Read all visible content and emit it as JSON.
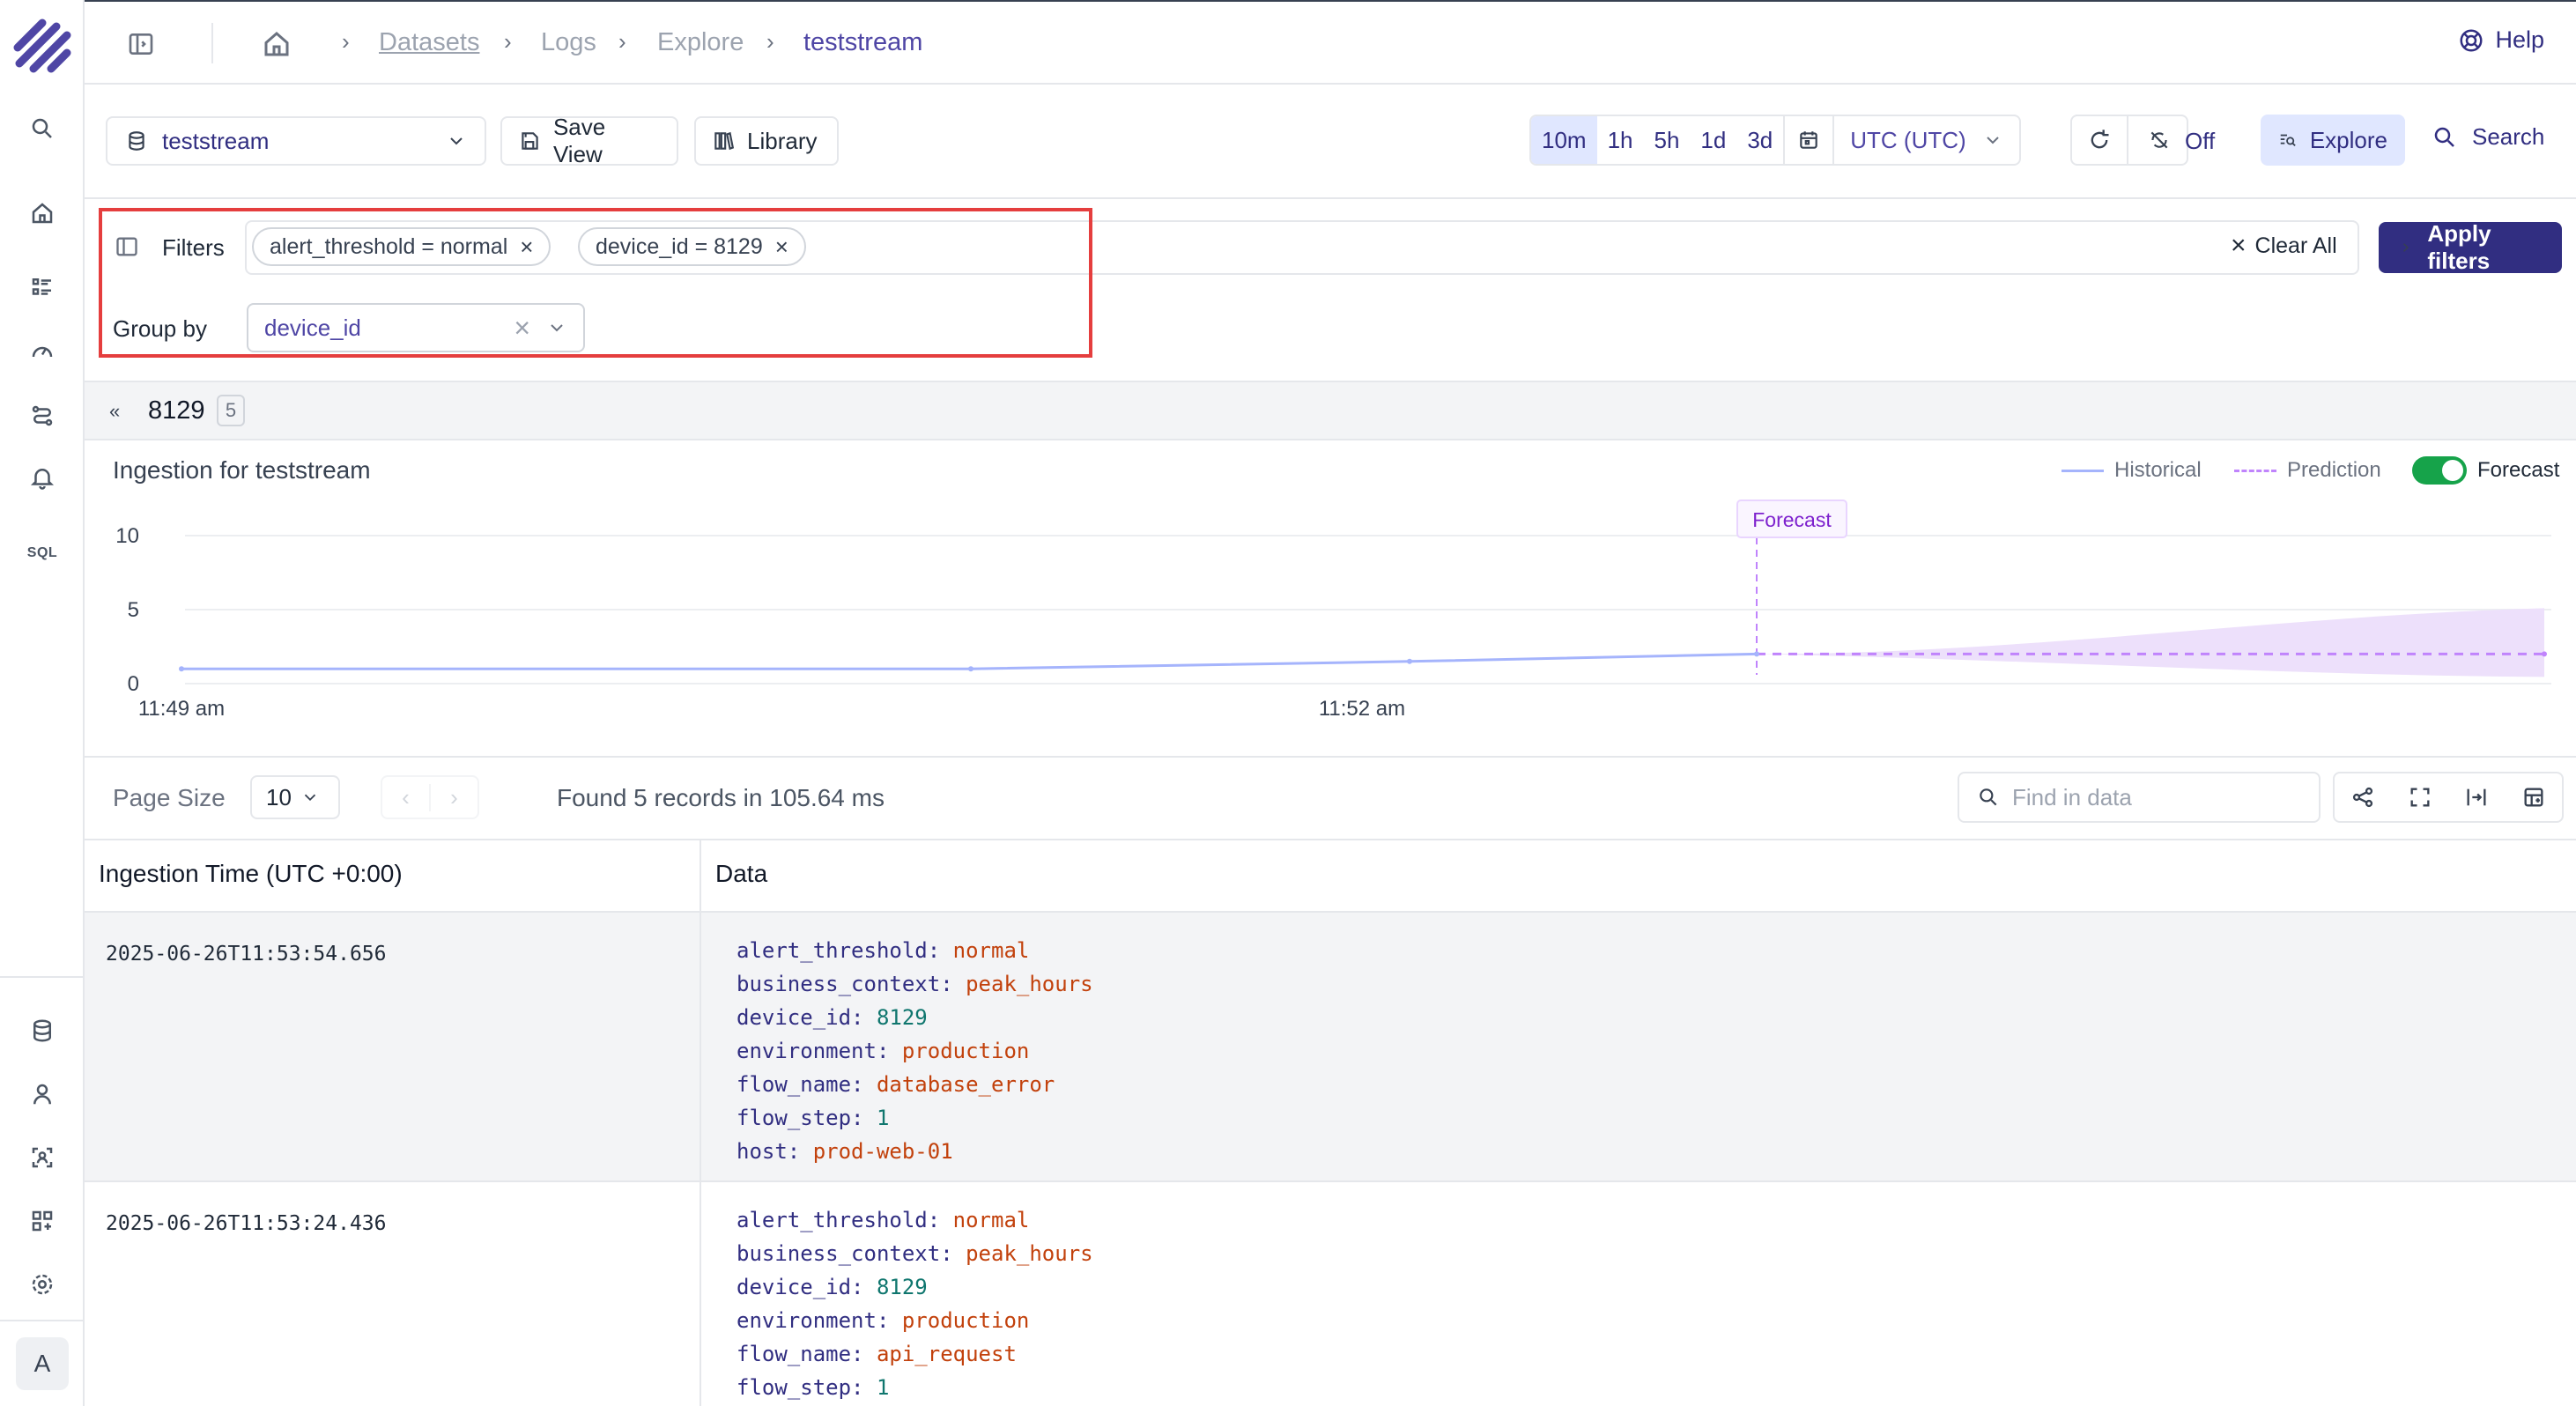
{
  "breadcrumb": [
    "Datasets",
    "Logs",
    "Explore",
    "teststream"
  ],
  "help_label": "Help",
  "toolbar": {
    "stream": "teststream",
    "save_view": "Save View",
    "library": "Library",
    "time_ranges": [
      "10m",
      "1h",
      "5h",
      "1d",
      "3d"
    ],
    "active_range": "10m",
    "timezone": "UTC (UTC)",
    "refresh_state": "Off",
    "explore": "Explore",
    "search": "Search"
  },
  "filters": {
    "label": "Filters",
    "chips": [
      "alert_threshold = normal",
      "device_id = 8129"
    ],
    "clear_all": "Clear All",
    "apply": "Apply filters",
    "group_by_label": "Group by",
    "group_by_value": "device_id"
  },
  "group": {
    "name": "8129",
    "count": "5"
  },
  "chart_data": {
    "type": "line",
    "title": "Ingestion for teststream",
    "legend": [
      "Historical",
      "Prediction"
    ],
    "forecast_toggle_label": "Forecast",
    "forecast_marker_label": "Forecast",
    "yticks": [
      "10",
      "5",
      "0"
    ],
    "ylim": [
      0,
      10
    ],
    "xticks": [
      "11:49 am",
      "11:52 am"
    ],
    "series": [
      {
        "name": "Historical",
        "values": [
          1,
          1,
          1.5,
          2
        ]
      },
      {
        "name": "Prediction",
        "values": [
          2,
          2,
          2
        ]
      }
    ],
    "colors": {
      "historical": "#a5b4fc",
      "prediction": "#c084fc",
      "band": "#ede0fb"
    }
  },
  "table": {
    "page_size_label": "Page Size",
    "page_size": "10",
    "found_text": "Found 5 records in 105.64 ms",
    "search_placeholder": "Find in data",
    "col_time": "Ingestion Time (UTC +0:00)",
    "col_data": "Data",
    "rows": [
      {
        "time": "2025-06-26T11:53:54.656",
        "fields": [
          [
            "alert_threshold",
            "normal",
            "s"
          ],
          [
            "business_context",
            "peak_hours",
            "s"
          ],
          [
            "device_id",
            "8129",
            "n"
          ],
          [
            "environment",
            "production",
            "s"
          ],
          [
            "flow_name",
            "database_error",
            "s"
          ],
          [
            "flow_step",
            "1",
            "n"
          ],
          [
            "host",
            "prod-web-01",
            "s"
          ]
        ]
      },
      {
        "time": "2025-06-26T11:53:24.436",
        "fields": [
          [
            "alert_threshold",
            "normal",
            "s"
          ],
          [
            "business_context",
            "peak_hours",
            "s"
          ],
          [
            "device_id",
            "8129",
            "n"
          ],
          [
            "environment",
            "production",
            "s"
          ],
          [
            "flow_name",
            "api_request",
            "s"
          ],
          [
            "flow_step",
            "1",
            "n"
          ]
        ]
      }
    ]
  }
}
